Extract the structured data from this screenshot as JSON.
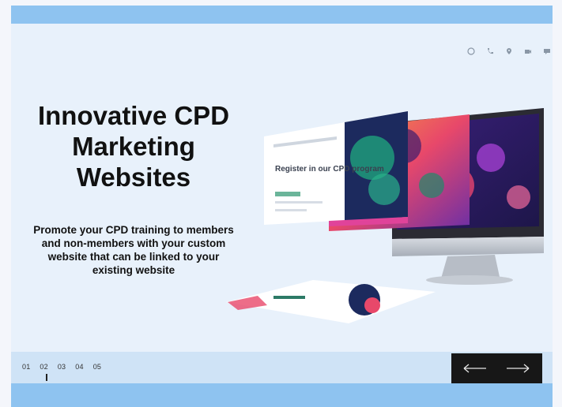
{
  "hero": {
    "headline": "Innovative CPD Marketing Websites",
    "subtext": "Promote your CPD training to members and non-members with your custom website that can be linked to your existing website",
    "screen_text": "Register in our CPD program"
  },
  "pagination": {
    "pages": [
      "01",
      "02",
      "03",
      "04",
      "05"
    ],
    "current": "02"
  },
  "icons": [
    "globe-icon",
    "phone-icon",
    "location-icon",
    "video-icon",
    "chat-icon"
  ],
  "navigation": {
    "prev": "arrow-left-icon",
    "next": "arrow-right-icon"
  },
  "colors": {
    "top_bar": "#8ec3f0",
    "background": "#e8f1fb",
    "nav_box": "#171717"
  }
}
